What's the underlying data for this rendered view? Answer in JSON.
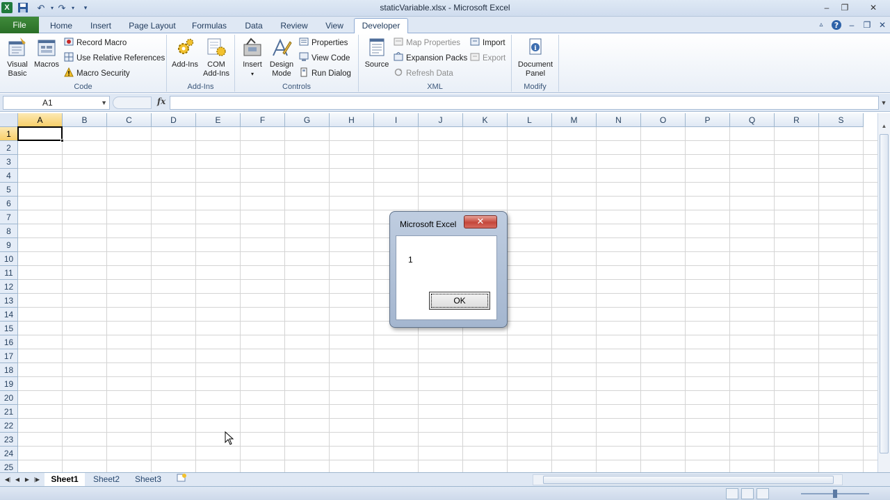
{
  "window": {
    "title": "staticVariable.xlsx - Microsoft Excel",
    "app_icon": "X",
    "minimize": "–",
    "restore": "❐",
    "close": "✕"
  },
  "qat": {
    "save_icon": "save-icon",
    "undo_icon": "undo-icon",
    "redo_icon": "redo-icon",
    "customize_icon": "dropdown-icon"
  },
  "tabs": [
    "File",
    "Home",
    "Insert",
    "Page Layout",
    "Formulas",
    "Data",
    "Review",
    "View",
    "Developer"
  ],
  "active_tab": "Developer",
  "ribbon": {
    "code": {
      "label": "Code",
      "visual_basic": [
        "Visual",
        "Basic"
      ],
      "macros": "Macros",
      "record_macro": "Record Macro",
      "use_relative": "Use Relative References",
      "macro_security": "Macro Security"
    },
    "addins": {
      "label": "Add-Ins",
      "addins": "Add-Ins",
      "com_addins": [
        "COM",
        "Add-Ins"
      ]
    },
    "controls": {
      "label": "Controls",
      "insert": "Insert",
      "design_mode": [
        "Design",
        "Mode"
      ],
      "properties": "Properties",
      "view_code": "View Code",
      "run_dialog": "Run Dialog"
    },
    "xml": {
      "label": "XML",
      "source": "Source",
      "map_properties": "Map Properties",
      "expansion_packs": "Expansion Packs",
      "refresh_data": "Refresh Data",
      "import": "Import",
      "export": "Export"
    },
    "modify": {
      "label": "Modify",
      "document_panel": [
        "Document",
        "Panel"
      ]
    }
  },
  "formula_bar": {
    "name_box": "A1",
    "fx": "fx",
    "value": ""
  },
  "grid": {
    "columns": [
      "A",
      "B",
      "C",
      "D",
      "E",
      "F",
      "G",
      "H",
      "I",
      "J",
      "K",
      "L",
      "M",
      "N",
      "O",
      "P",
      "Q",
      "R",
      "S"
    ],
    "rows": [
      "1",
      "2",
      "3",
      "4",
      "5",
      "6",
      "7",
      "8",
      "9",
      "10",
      "11",
      "12",
      "13",
      "14",
      "15",
      "16",
      "17",
      "18",
      "19",
      "20",
      "21",
      "22",
      "23",
      "24",
      "25"
    ],
    "active_cell": "A1"
  },
  "sheets": [
    "Sheet1",
    "Sheet2",
    "Sheet3"
  ],
  "active_sheet": "Sheet1",
  "dialog": {
    "title": "Microsoft Excel",
    "close": "✕",
    "message": "1",
    "ok": "OK"
  },
  "colors": {
    "file_tab": "#2a6f27",
    "ribbon_bg": "#dfe8f4",
    "active_header": "#f8cf6a",
    "dialog_close": "#c4473b"
  }
}
